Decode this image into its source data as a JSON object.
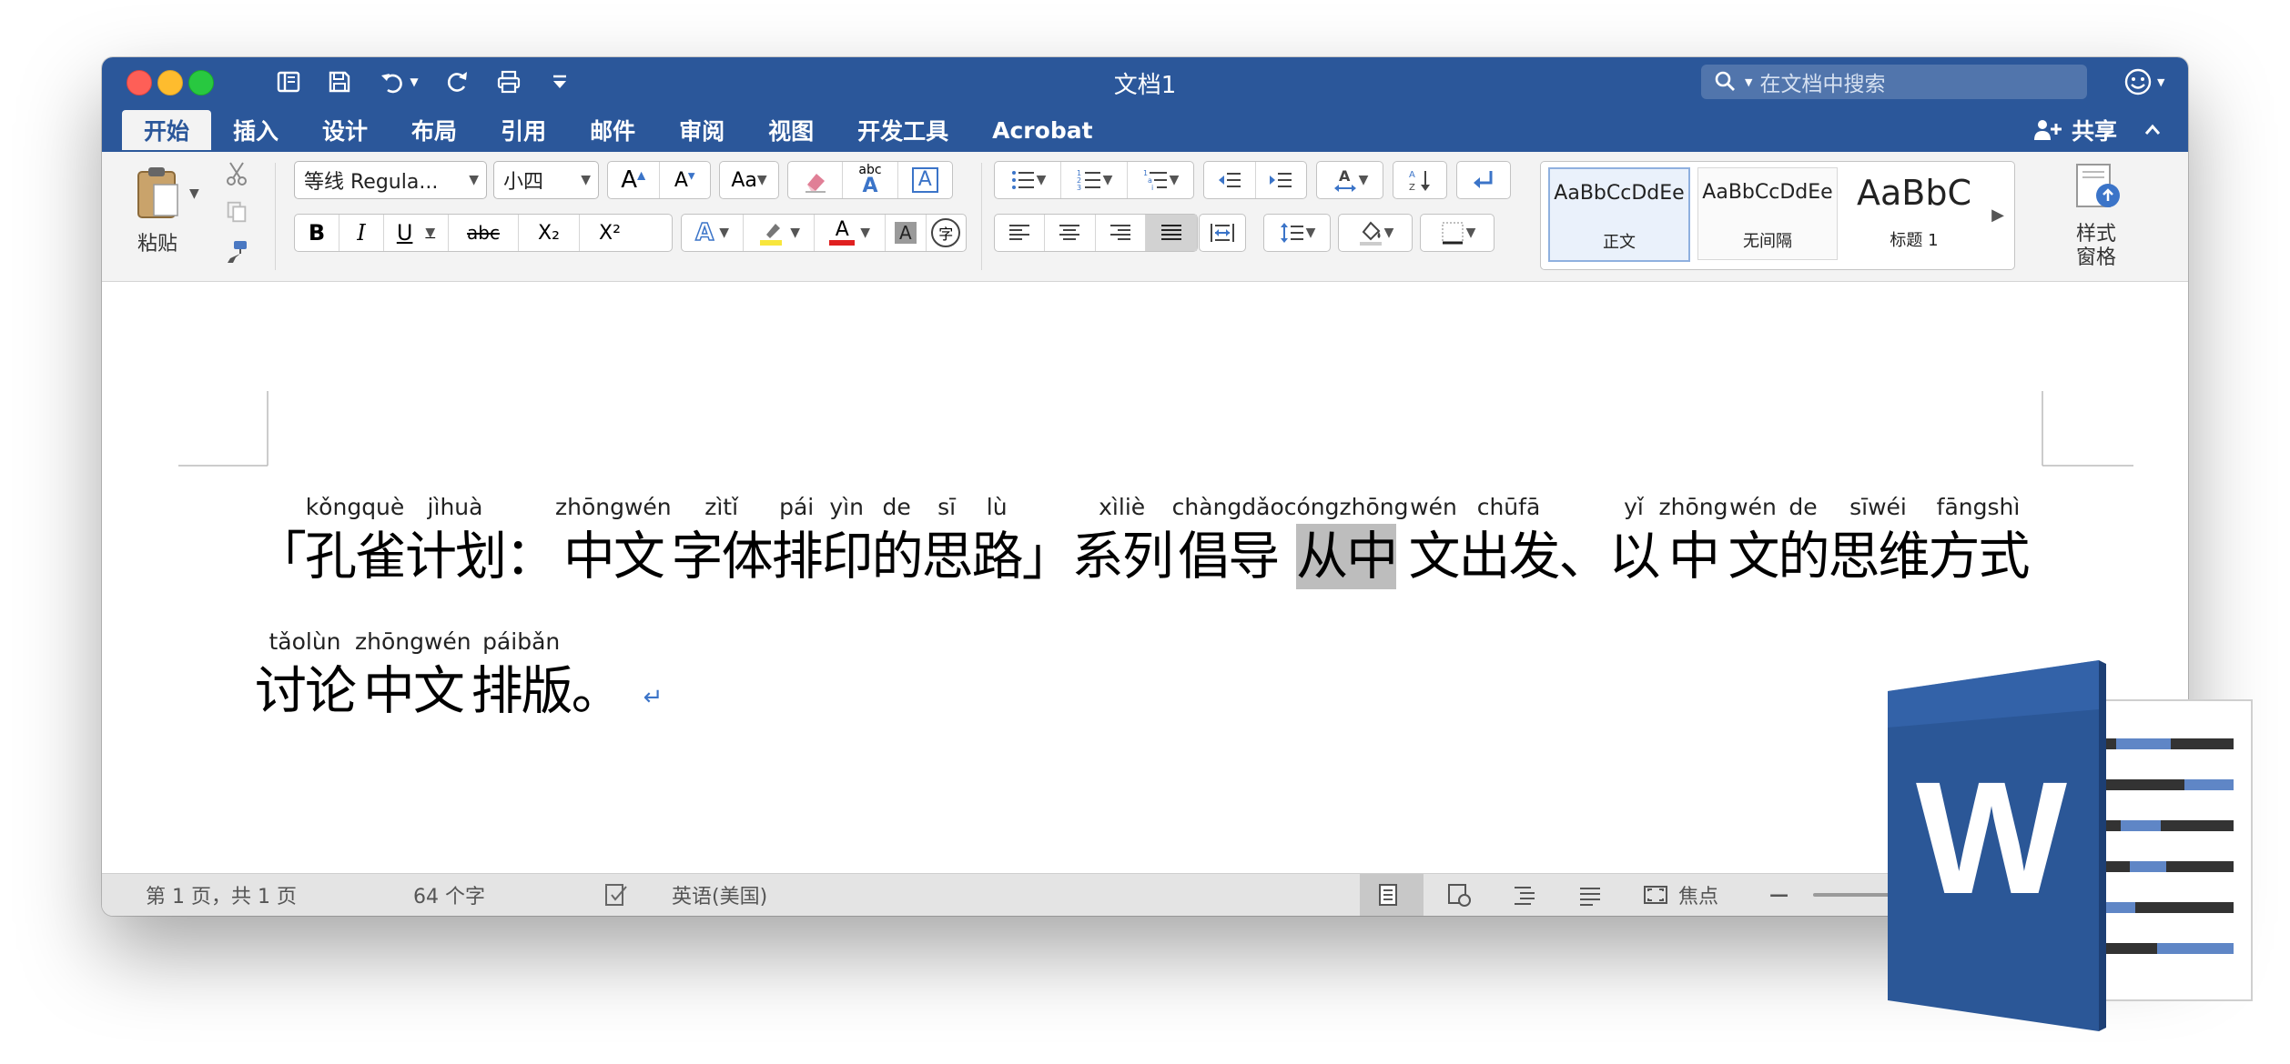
{
  "window": {
    "title": "文档1",
    "search_placeholder": "在文档中搜索"
  },
  "tabs": [
    "开始",
    "插入",
    "设计",
    "布局",
    "引用",
    "邮件",
    "审阅",
    "视图",
    "开发工具",
    "Acrobat"
  ],
  "share_label": "共享",
  "ribbon": {
    "paste_label": "粘贴",
    "font_name": "等线 Regula...",
    "font_size": "小四",
    "style_pane_label": "样式\n窗格",
    "style_pane_line1": "样式",
    "style_pane_line2": "窗格",
    "styles": [
      {
        "preview": "AaBbCcDdEe",
        "name": "正文"
      },
      {
        "preview": "AaBbCcDdEe",
        "name": "无间隔"
      },
      {
        "preview": "AaBbC",
        "name": "标题 1"
      }
    ],
    "format_buttons": {
      "bold": "B",
      "italic": "I",
      "underline": "U",
      "strike": "abc",
      "subscript": "X₂",
      "superscript": "X²",
      "phonetic": "字",
      "abc_label": "abc"
    }
  },
  "document": {
    "line1": [
      {
        "t": "「",
        "p": ""
      },
      {
        "t": "孔雀",
        "p": "kǒngquè"
      },
      {
        "t": "计划",
        "p": "jìhuà"
      },
      {
        "t": "：",
        "p": ""
      },
      {
        "t": "中文",
        "p": "zhōngwén"
      },
      {
        "t": "字体",
        "p": "zìtǐ"
      },
      {
        "t": "排",
        "p": "pái"
      },
      {
        "t": "印",
        "p": "yìn"
      },
      {
        "t": "的",
        "p": "de"
      },
      {
        "t": "思",
        "p": "sī"
      },
      {
        "t": "路",
        "p": "lù"
      },
      {
        "t": "」",
        "p": ""
      },
      {
        "t": "系列",
        "p": "xìliè"
      },
      {
        "t": "倡导",
        "p": "chàngdǎo"
      },
      {
        "t": "从中",
        "p": "cóngzhōng",
        "highlight": true
      },
      {
        "t": "文",
        "p": "wén"
      },
      {
        "t": "出发",
        "p": "chūfā"
      },
      {
        "t": "、",
        "p": ""
      },
      {
        "t": "以",
        "p": "yǐ"
      },
      {
        "t": "中",
        "p": "zhōng"
      },
      {
        "t": "文",
        "p": "wén"
      },
      {
        "t": "的",
        "p": "de"
      },
      {
        "t": "思维",
        "p": "sīwéi"
      },
      {
        "t": "方式",
        "p": "fāngshì"
      }
    ],
    "line2": [
      {
        "t": "讨论",
        "p": "tǎolùn"
      },
      {
        "t": "中文",
        "p": "zhōngwén"
      },
      {
        "t": "排版",
        "p": "páibǎn"
      },
      {
        "t": "。",
        "p": ""
      }
    ],
    "paragraph_mark": "↵"
  },
  "status": {
    "page": "第 1 页，共 1 页",
    "words": "64 个字",
    "language": "英语(美国)",
    "focus": "焦点"
  },
  "colors": {
    "brand": "#2b579a",
    "ribbon_bg": "#f3f3f3",
    "highlight_yellow": "#f8e63c",
    "font_color_red": "#e02020"
  }
}
